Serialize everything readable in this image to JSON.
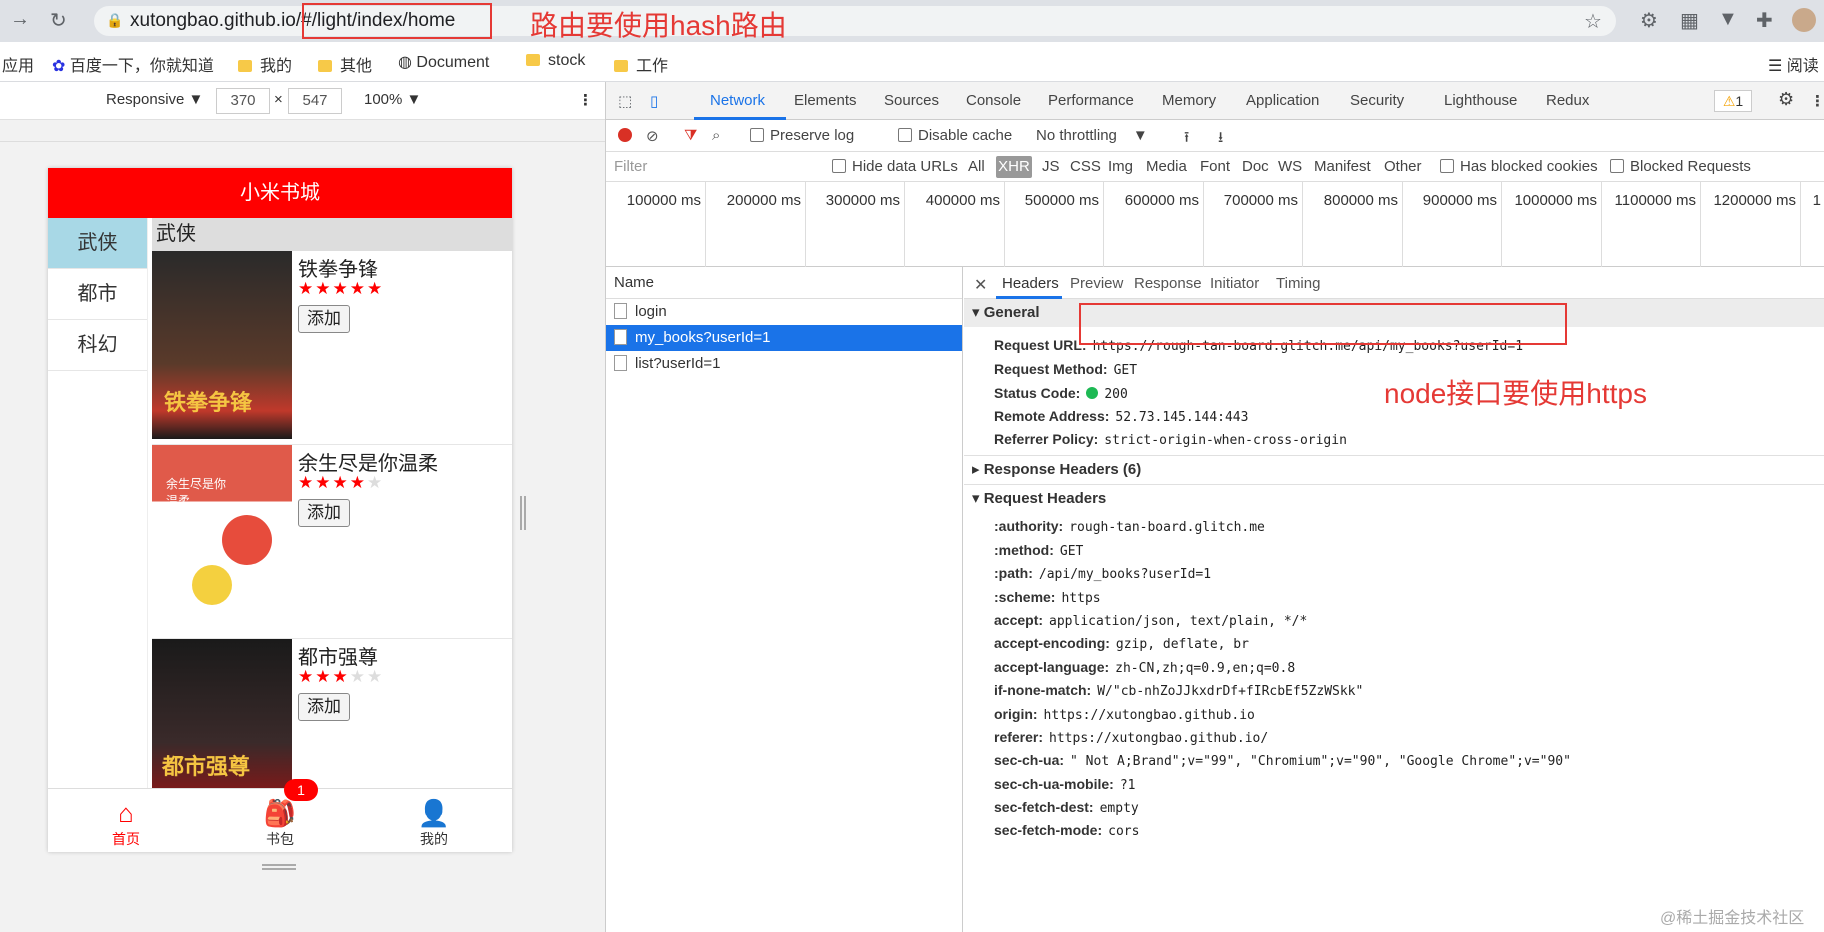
{
  "browser": {
    "url_host": "xutongbao.github.io",
    "url_hash": "/#/light/index/home",
    "annotation_hash": "路由要使用hash路由",
    "bookmarks": [
      "应用",
      "百度一下，你就知道",
      "我的",
      "其他",
      "Document",
      "stock",
      "工作",
      "阅读"
    ]
  },
  "device_toolbar": {
    "mode": "Responsive ▼",
    "width": "370",
    "height": "547",
    "times": "×",
    "zoom": "100% ▼"
  },
  "app": {
    "title": "小米书城",
    "categories": [
      "武侠",
      "都市",
      "科幻"
    ],
    "active_category": "武侠",
    "books": [
      {
        "title": "铁拳争锋",
        "rating": 5,
        "cover_text": "铁拳争锋",
        "button": "添加"
      },
      {
        "title": "余生尽是你温柔",
        "rating": 4,
        "cover_text": "余生尽是你温柔",
        "button": "添加"
      },
      {
        "title": "都市强尊",
        "rating": 3,
        "cover_text": "都市强尊",
        "button": "添加"
      }
    ],
    "tabs": [
      "首页",
      "书包",
      "我的"
    ],
    "cart_badge": "1",
    "accent": "#ff0000"
  },
  "devtools": {
    "tabs": [
      "Network",
      "Elements",
      "Sources",
      "Console",
      "Performance",
      "Memory",
      "Application",
      "Security",
      "Lighthouse",
      "Redux"
    ],
    "warning_count": "1",
    "toolbar": {
      "preserve_log": "Preserve log",
      "disable_cache": "Disable cache",
      "throttling": "No throttling"
    },
    "filter": {
      "placeholder": "Filter",
      "hide_data_urls": "Hide data URLs",
      "types": [
        "All",
        "XHR",
        "JS",
        "CSS",
        "Img",
        "Media",
        "Font",
        "Doc",
        "WS",
        "Manifest",
        "Other"
      ],
      "blocked_cookies": "Has blocked cookies",
      "blocked_requests": "Blocked Requests"
    },
    "timeline": [
      "100000 ms",
      "200000 ms",
      "300000 ms",
      "400000 ms",
      "500000 ms",
      "600000 ms",
      "700000 ms",
      "800000 ms",
      "900000 ms",
      "1000000 ms",
      "1100000 ms",
      "1200000 ms",
      "1"
    ],
    "name_header": "Name",
    "requests": [
      "login",
      "my_books?userId=1",
      "list?userId=1"
    ],
    "detail_tabs": [
      "Headers",
      "Preview",
      "Response",
      "Initiator",
      "Timing"
    ],
    "general": {
      "title": "General",
      "rows": [
        {
          "k": "Request URL:",
          "v": "https://rough-tan-board.glitch.me/api/my_books?userId=1"
        },
        {
          "k": "Request Method:",
          "v": "GET"
        },
        {
          "k": "Status Code:",
          "v": "200"
        },
        {
          "k": "Remote Address:",
          "v": "52.73.145.144:443"
        },
        {
          "k": "Referrer Policy:",
          "v": "strict-origin-when-cross-origin"
        }
      ]
    },
    "response_headers": "Response Headers (6)",
    "request_headers_title": "Request Headers",
    "request_headers": [
      {
        "k": ":authority:",
        "v": "rough-tan-board.glitch.me"
      },
      {
        "k": ":method:",
        "v": "GET"
      },
      {
        "k": ":path:",
        "v": "/api/my_books?userId=1"
      },
      {
        "k": ":scheme:",
        "v": "https"
      },
      {
        "k": "accept:",
        "v": "application/json, text/plain, */*"
      },
      {
        "k": "accept-encoding:",
        "v": "gzip, deflate, br"
      },
      {
        "k": "accept-language:",
        "v": "zh-CN,zh;q=0.9,en;q=0.8"
      },
      {
        "k": "if-none-match:",
        "v": "W/\"cb-nhZoJJkxdrDf+fIRcbEf5ZzWSkk\""
      },
      {
        "k": "origin:",
        "v": "https://xutongbao.github.io"
      },
      {
        "k": "referer:",
        "v": "https://xutongbao.github.io/"
      },
      {
        "k": "sec-ch-ua:",
        "v": "\" Not A;Brand\";v=\"99\", \"Chromium\";v=\"90\", \"Google Chrome\";v=\"90\""
      },
      {
        "k": "sec-ch-ua-mobile:",
        "v": "?1"
      },
      {
        "k": "sec-fetch-dest:",
        "v": "empty"
      },
      {
        "k": "sec-fetch-mode:",
        "v": "cors"
      }
    ],
    "annotation_node": "node接口要使用https"
  },
  "watermark": "@稀土掘金技术社区"
}
